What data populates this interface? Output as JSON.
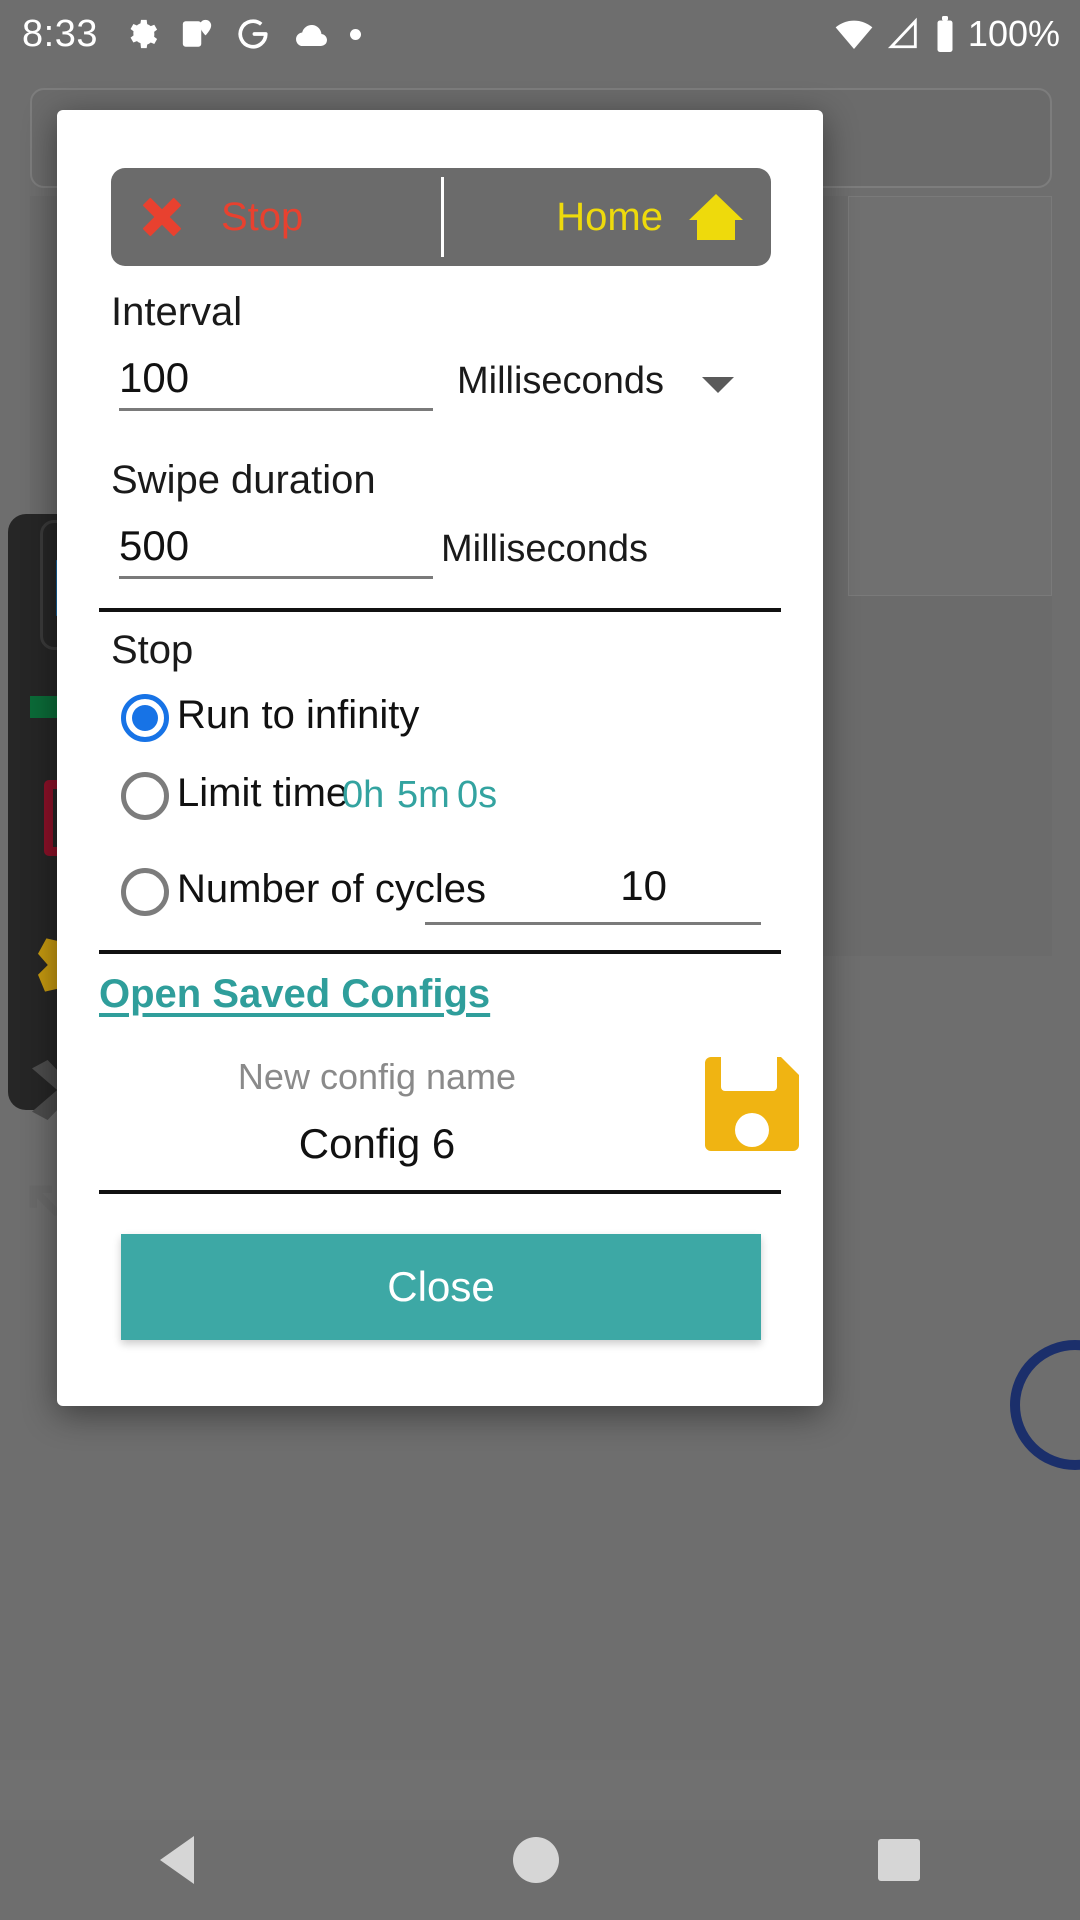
{
  "statusbar": {
    "time": "8:33",
    "icons": [
      "gear-icon",
      "maps-icon",
      "google-g-icon",
      "cloud-icon",
      "dot-icon"
    ],
    "wifi": "wifi-icon",
    "signal": "signal-icon",
    "battery_icon": "battery-icon",
    "battery_text": "100%"
  },
  "dialog": {
    "toolbar": {
      "stop_label": "Stop",
      "stop_icon": "close-x-icon",
      "home_label": "Home",
      "home_icon": "home-icon"
    },
    "interval": {
      "label": "Interval",
      "value": "100",
      "unit": "Milliseconds",
      "dropdown_icon": "chevron-down-icon"
    },
    "swipe_duration": {
      "label": "Swipe duration",
      "value": "500",
      "unit": "Milliseconds"
    },
    "stop_section": {
      "label": "Stop",
      "options": [
        {
          "label": "Run to infinity",
          "selected": true
        },
        {
          "label": "Limit time",
          "selected": false
        },
        {
          "label": "Number of cycles",
          "selected": false
        }
      ],
      "limit_time": {
        "hours": "0h",
        "minutes": "5m",
        "seconds": "0s"
      },
      "cycles_value": "10"
    },
    "configs": {
      "open_link": "Open Saved Configs",
      "name_hint": "New config name",
      "name_value": "Config 6",
      "save_icon": "save-floppy-icon"
    },
    "close_label": "Close"
  },
  "navbar": {
    "back": "back-triangle-icon",
    "home": "home-circle-icon",
    "recents": "recents-square-icon"
  },
  "colors": {
    "accent_teal": "#3da8a5",
    "link_teal": "#2f9e9b",
    "stop_red": "#e8412f",
    "home_yellow": "#eeda0c",
    "radio_blue": "#1773e6",
    "save_yellow": "#f0b412"
  }
}
